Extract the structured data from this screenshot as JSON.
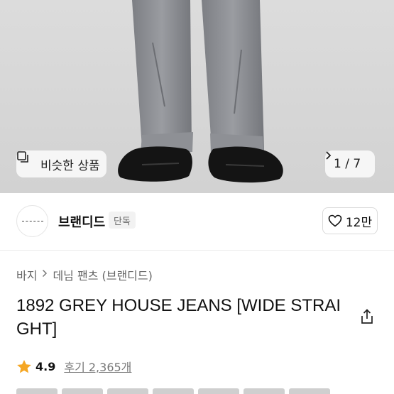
{
  "gallery": {
    "similar_label": "비슷한 상품",
    "counter": "1 / 7"
  },
  "brand": {
    "name": "브랜디드",
    "badge": "단독",
    "likes": "12만"
  },
  "breadcrumb": {
    "level1": "바지",
    "level2": "데님 팬츠 (브랜디드)"
  },
  "product": {
    "title": "1892 GREY HOUSE JEANS [WIDE STRAIGHT]"
  },
  "rating": {
    "score": "4.9",
    "reviews": "후기 2,365개"
  },
  "colors": {
    "star": "#f5a623",
    "text_muted": "#777777"
  }
}
